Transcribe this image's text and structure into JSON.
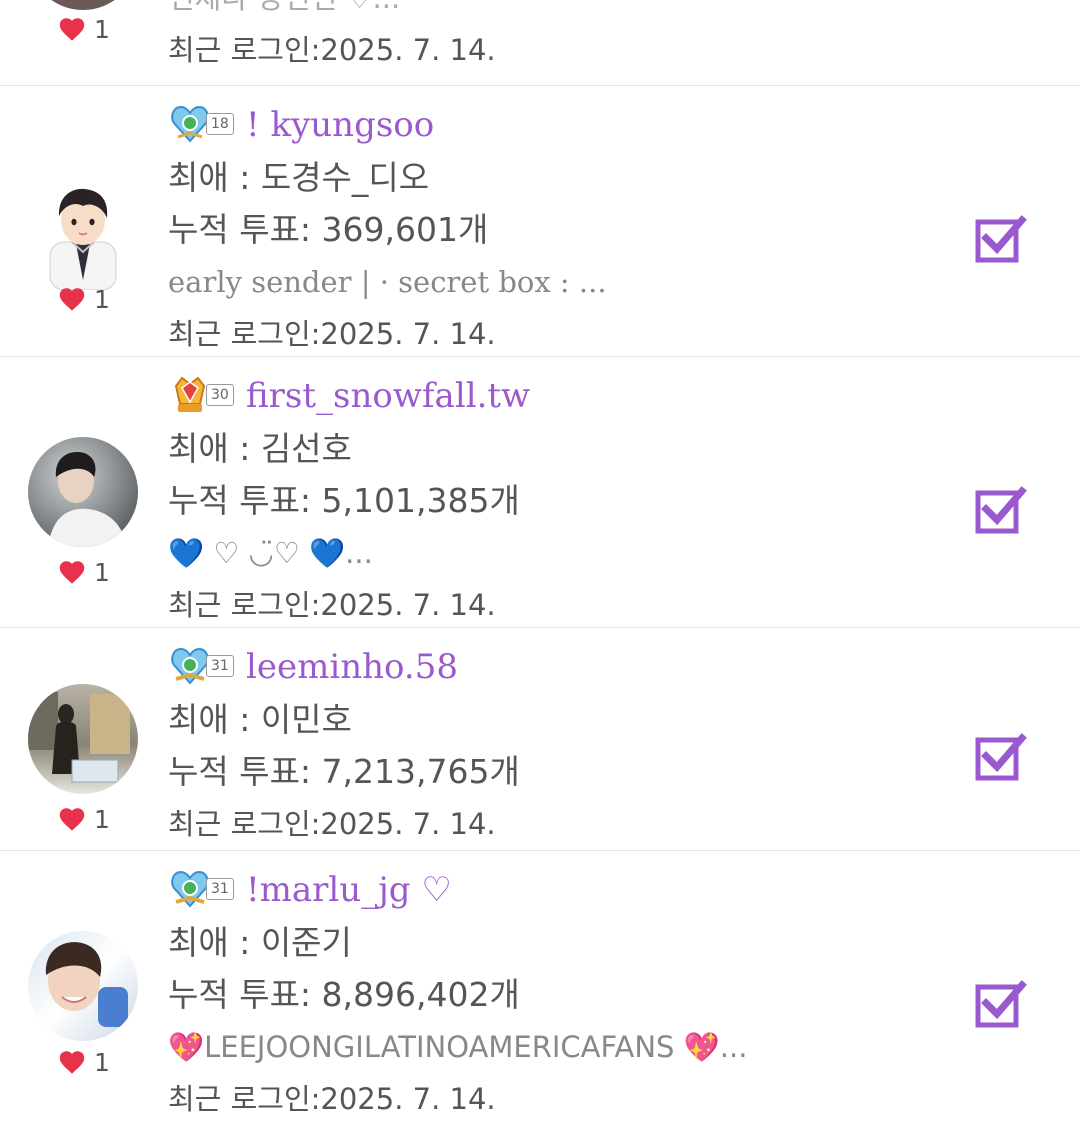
{
  "colors": {
    "accent": "#9b59d0",
    "heart": "#e8314a",
    "text": "#555555",
    "muted": "#888888"
  },
  "rows": [
    {
      "username": "",
      "level": "",
      "favorite": "",
      "votes": "",
      "bio": "언제나 당신편 ♡...",
      "last_login": "최근 로그인:2025. 7. 14.",
      "likes": "1",
      "checked": false
    },
    {
      "username": "! kyungsoo",
      "level": "18",
      "favorite": "최애 : 도경수_디오",
      "votes": "누적 투표: 369,601개",
      "bio": "early sender | · secret box : ...",
      "last_login": "최근 로그인:2025. 7. 14.",
      "likes": "1",
      "checked": true
    },
    {
      "username": "first_snowfall.tw",
      "level": "30",
      "favorite": "최애 : 김선호",
      "votes": "누적 투표: 5,101,385개",
      "bio": "💙 ♡ ◡̈♡ 💙...",
      "last_login": "최근 로그인:2025. 7. 14.",
      "likes": "1",
      "checked": true
    },
    {
      "username": "leeminho.58",
      "level": "31",
      "favorite": "최애 : 이민호",
      "votes": "누적 투표: 7,213,765개",
      "bio": "",
      "last_login": "최근 로그인:2025. 7. 14.",
      "likes": "1",
      "checked": true
    },
    {
      "username": "!marlu_jg ♡",
      "level": "31",
      "favorite": "최애 : 이준기",
      "votes": "누적 투표: 8,896,402개",
      "bio": "💖LEEJOONGILATINOAMERICAFANS 💖...",
      "last_login": "최근 로그인:2025. 7. 14.",
      "likes": "1",
      "checked": true
    }
  ]
}
